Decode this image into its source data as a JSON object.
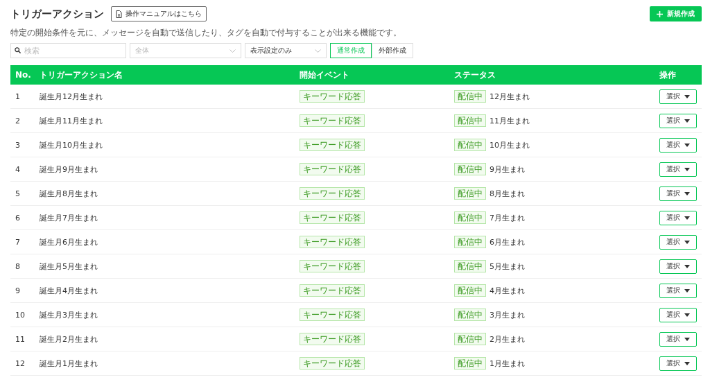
{
  "header": {
    "title": "トリガーアクション",
    "manual_button": "操作マニュアルはこちら",
    "new_button": "新規作成"
  },
  "description": "特定の開始条件を元に、メッセージを自動で送信したり、タグを自動で付与することが出来る機能です。",
  "filters": {
    "search": {
      "placeholder": "検索"
    },
    "selects": [
      {
        "value": "全体",
        "disabled": true
      },
      {
        "value": "表示設定のみ",
        "disabled": false
      }
    ],
    "create_tabs": [
      {
        "label": "通常作成",
        "selected": true
      },
      {
        "label": "外部作成",
        "selected": false
      }
    ]
  },
  "table": {
    "columns": [
      "No.",
      "トリガーアクション名",
      "開始イベント",
      "ステータス",
      "操作"
    ],
    "rows": [
      {
        "no": "1",
        "name": "誕生月12月生まれ",
        "event": "キーワード応答",
        "status": "配信中",
        "note": "12月生まれ",
        "action": "選択"
      },
      {
        "no": "2",
        "name": "誕生月11月生まれ",
        "event": "キーワード応答",
        "status": "配信中",
        "note": "11月生まれ",
        "action": "選択"
      },
      {
        "no": "3",
        "name": "誕生月10月生まれ",
        "event": "キーワード応答",
        "status": "配信中",
        "note": "10月生まれ",
        "action": "選択"
      },
      {
        "no": "4",
        "name": "誕生月9月生まれ",
        "event": "キーワード応答",
        "status": "配信中",
        "note": "9月生まれ",
        "action": "選択"
      },
      {
        "no": "5",
        "name": "誕生月8月生まれ",
        "event": "キーワード応答",
        "status": "配信中",
        "note": "8月生まれ",
        "action": "選択"
      },
      {
        "no": "6",
        "name": "誕生月7月生まれ",
        "event": "キーワード応答",
        "status": "配信中",
        "note": "7月生まれ",
        "action": "選択"
      },
      {
        "no": "7",
        "name": "誕生月6月生まれ",
        "event": "キーワード応答",
        "status": "配信中",
        "note": "6月生まれ",
        "action": "選択"
      },
      {
        "no": "8",
        "name": "誕生月5月生まれ",
        "event": "キーワード応答",
        "status": "配信中",
        "note": "5月生まれ",
        "action": "選択"
      },
      {
        "no": "9",
        "name": "誕生月4月生まれ",
        "event": "キーワード応答",
        "status": "配信中",
        "note": "4月生まれ",
        "action": "選択"
      },
      {
        "no": "10",
        "name": "誕生月3月生まれ",
        "event": "キーワード応答",
        "status": "配信中",
        "note": "3月生まれ",
        "action": "選択"
      },
      {
        "no": "11",
        "name": "誕生月2月生まれ",
        "event": "キーワード応答",
        "status": "配信中",
        "note": "2月生まれ",
        "action": "選択"
      },
      {
        "no": "12",
        "name": "誕生月1月生まれ",
        "event": "キーワード応答",
        "status": "配信中",
        "note": "1月生まれ",
        "action": "選択"
      }
    ]
  }
}
